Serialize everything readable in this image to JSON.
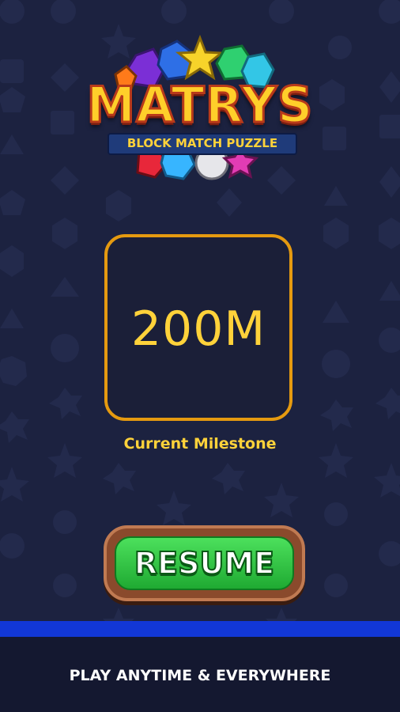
{
  "logo": {
    "title": "MATRYS",
    "subtitle": "BLOCK MATCH PUZZLE",
    "gem_colors": [
      "#7b2fd6",
      "#2e6fe6",
      "#f7d32a",
      "#2fd070",
      "#33c6e6",
      "#e8273a",
      "#37b5ff",
      "#e6e6ea",
      "#e23cb4",
      "#ff7a1a"
    ]
  },
  "milestone": {
    "value": "200M",
    "label": "Current Milestone"
  },
  "resume_button": {
    "label": "RESUME"
  },
  "footer": {
    "tagline": "PLAY ANYTIME & EVERYWHERE"
  },
  "colors": {
    "background": "#1c2240",
    "accent_gold": "#ffd23a",
    "box_border": "#e59a10",
    "button_green": "#2fc443",
    "blue_bar": "#1237d6"
  }
}
